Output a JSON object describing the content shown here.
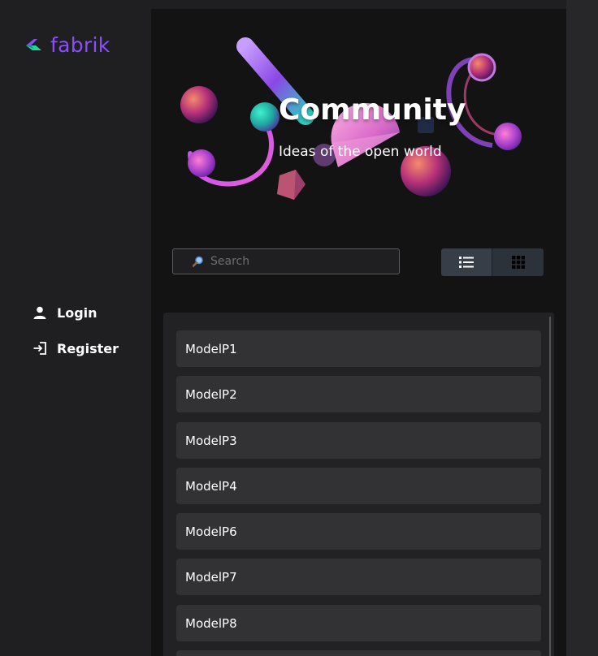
{
  "app": {
    "brand": "fabrik"
  },
  "nav": {
    "login": "Login",
    "register": "Register"
  },
  "hero": {
    "title": "Community",
    "subtitle": "Ideas of the open world"
  },
  "search": {
    "placeholder": "Search",
    "value": ""
  },
  "view_toggle": {
    "active": "list",
    "options": [
      "list",
      "grid"
    ]
  },
  "models": [
    {
      "label": "ModelP1"
    },
    {
      "label": "ModelP2"
    },
    {
      "label": "ModelP3"
    },
    {
      "label": "ModelP4"
    },
    {
      "label": "ModelP6"
    },
    {
      "label": "ModelP7"
    },
    {
      "label": "ModelP8"
    }
  ],
  "colors": {
    "brand": "#8b4dff",
    "brand_accent": "#22d3a6",
    "background": "#1f1f21",
    "content_bg": "#131313",
    "item_bg": "#323234"
  }
}
